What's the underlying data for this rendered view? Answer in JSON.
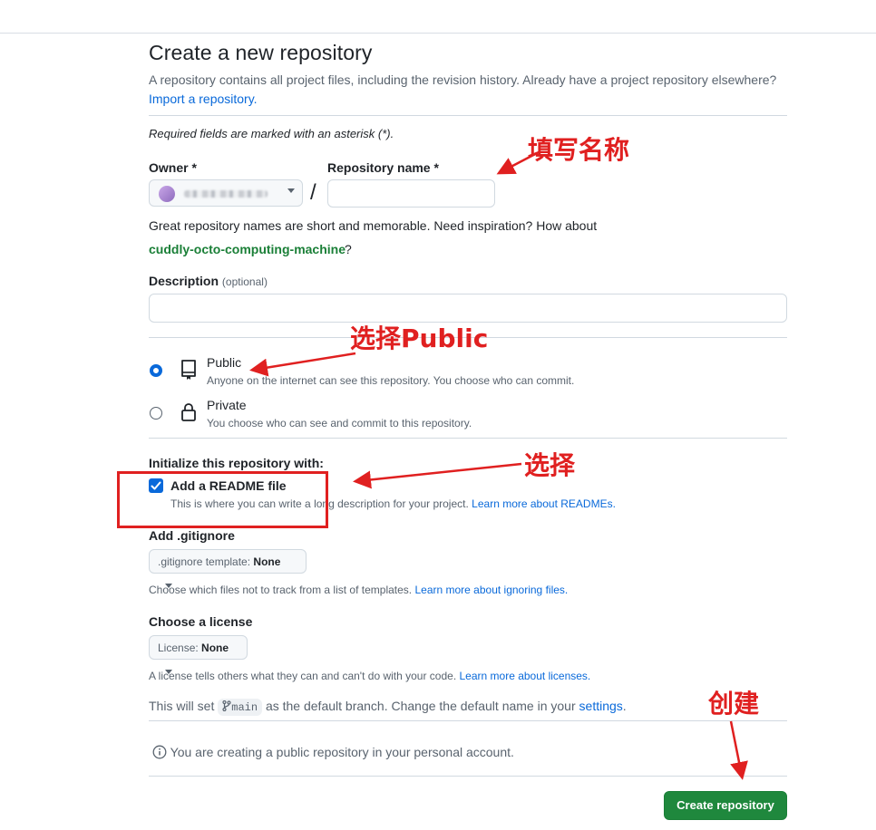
{
  "page": {
    "title": "Create a new repository",
    "subtitle": "A repository contains all project files, including the revision history. Already have a project repository elsewhere?",
    "import_link": "Import a repository.",
    "required_note": "Required fields are marked with an asterisk (*)."
  },
  "owner": {
    "label": "Owner *"
  },
  "repo_name": {
    "label": "Repository name *",
    "value": ""
  },
  "name_hint": {
    "text": "Great repository names are short and memorable. Need inspiration? How about",
    "suggestion": "cuddly-octo-computing-machine",
    "suffix": "?"
  },
  "description": {
    "label": "Description",
    "optional": "(optional)",
    "value": ""
  },
  "visibility": {
    "public": {
      "title": "Public",
      "desc": "Anyone on the internet can see this repository. You choose who can commit.",
      "selected": true
    },
    "private": {
      "title": "Private",
      "desc": "You choose who can see and commit to this repository.",
      "selected": false
    }
  },
  "initialize": {
    "heading": "Initialize this repository with:",
    "readme": {
      "label": "Add a README file",
      "desc": "This is where you can write a long description for your project.",
      "link": "Learn more about READMEs.",
      "checked": true
    }
  },
  "gitignore": {
    "heading": "Add .gitignore",
    "button_prefix": ".gitignore template:",
    "button_value": "None",
    "help": "Choose which files not to track from a list of templates.",
    "help_link": "Learn more about ignoring files."
  },
  "license": {
    "heading": "Choose a license",
    "button_prefix": "License:",
    "button_value": "None",
    "help": "A license tells others what they can and can't do with your code.",
    "help_link": "Learn more about licenses."
  },
  "branch_note": {
    "prefix": "This will set",
    "branch": "main",
    "suffix": "as the default branch. Change the default name in your",
    "link": "settings",
    "end": "."
  },
  "info_note": "You are creating a public repository in your personal account.",
  "create_button": "Create repository",
  "annotations": {
    "fill_name": "填写名称",
    "choose_public": "选择Public",
    "choose": "选择",
    "create": "创建",
    "color": "#e02020"
  },
  "colors": {
    "link": "#0969da",
    "primary_button": "#1f883d",
    "suggestion": "#1a7f37"
  }
}
